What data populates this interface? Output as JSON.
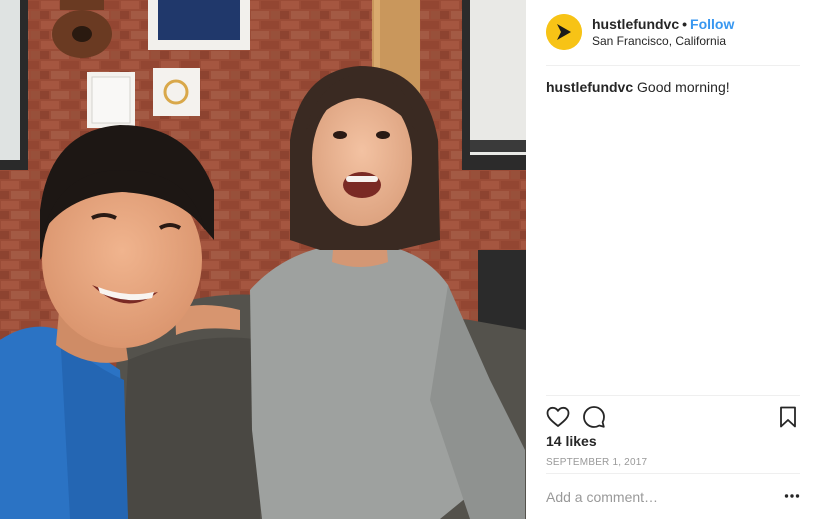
{
  "post": {
    "image_alt": "",
    "header": {
      "username": "hustlefundvc",
      "separator": "•",
      "follow_label": "Follow",
      "location": "San Francisco, California",
      "avatar_icon": "play-arrow-logo-icon",
      "avatar_color": "#f7c316"
    },
    "caption": {
      "username": "hustlefundvc",
      "text": "Good morning!"
    },
    "actions": {
      "like_icon": "heart-outline-icon",
      "comment_icon": "speech-bubble-icon",
      "save_icon": "bookmark-icon"
    },
    "likes_text": "14 likes",
    "date_text": "SEPTEMBER 1, 2017",
    "comment": {
      "placeholder": "Add a comment…",
      "value": "",
      "more_icon": "ellipsis-icon"
    }
  },
  "colors": {
    "link": "#3897f0",
    "text": "#262626",
    "muted": "#999999",
    "divider": "#efefef"
  }
}
